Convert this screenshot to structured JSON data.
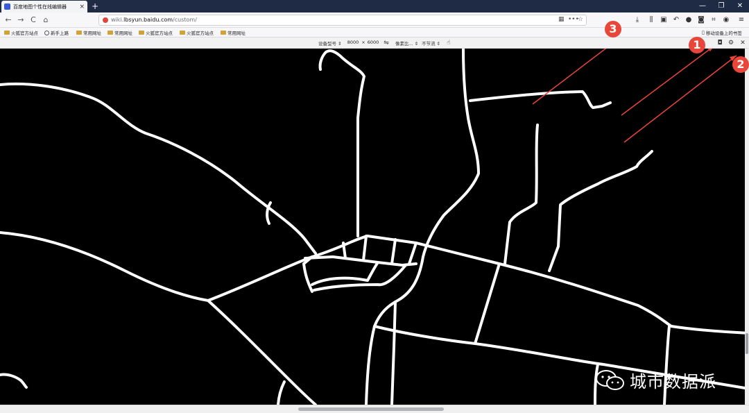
{
  "tab": {
    "title": "百度地图个性在线编辑器",
    "close": "×"
  },
  "newtab": "+",
  "window": {
    "minimize": "—",
    "restore": "❐",
    "close": "✕"
  },
  "nav": {
    "back": "←",
    "forward": "→",
    "reload": "C",
    "home": "⌂",
    "url_prefix": "wiki.",
    "url_domain": "lbsyun.baidu.com",
    "url_path": "/custom/",
    "more": "•••",
    "bookmark_star": "☆"
  },
  "toolbar_icons": [
    "download-icon",
    "library-icon",
    "reader-icon",
    "undo-icon",
    "extension-icon",
    "password-icon",
    "screenshot-crop-icon",
    "account-icon",
    "menu-icon"
  ],
  "bookmarks": {
    "items": [
      {
        "label": "火狐官方站点",
        "icon": "folder-icon"
      },
      {
        "label": "新手上路",
        "icon": "globe-icon"
      },
      {
        "label": "常用网址",
        "icon": "folder-icon"
      },
      {
        "label": "常用网址",
        "icon": "folder-icon"
      },
      {
        "label": "火狐官方站点",
        "icon": "folder-icon"
      },
      {
        "label": "火狐官方站点",
        "icon": "folder-icon"
      },
      {
        "label": "常用网址",
        "icon": "folder-icon"
      }
    ],
    "mobile": "移动设备上的书签"
  },
  "device_bar": {
    "device_label": "设备型号 ⇕",
    "width": "8000",
    "times": "×",
    "height": "6000",
    "pixel_ratio": "像素比... ⇕",
    "throttle": "不节流 ⇕"
  },
  "watermark": {
    "text": "城市数据派"
  },
  "annotations": [
    {
      "number": "1"
    },
    {
      "number": "2"
    },
    {
      "number": "3"
    }
  ],
  "colors": {
    "annotation": "#e8463a",
    "road": "#ffffff",
    "map_bg": "#000000"
  }
}
